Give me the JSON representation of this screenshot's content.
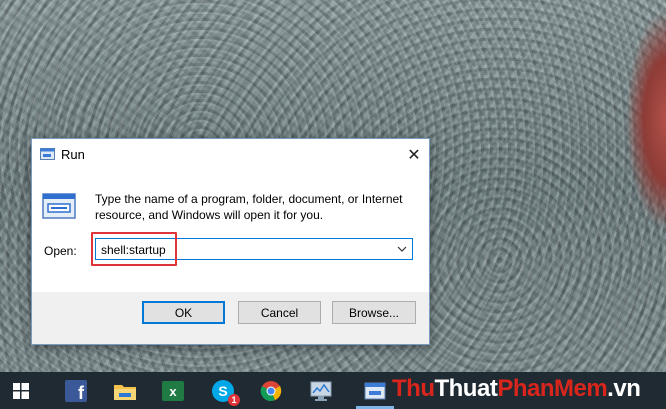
{
  "dialog": {
    "title": "Run",
    "close_glyph": "✕",
    "description": "Type the name of a program, folder, document, or Internet resource, and Windows will open it for you.",
    "open_label": "Open:",
    "open_value": "shell:startup",
    "buttons": {
      "ok": "OK",
      "cancel": "Cancel",
      "browse": "Browse..."
    }
  },
  "taskbar": {
    "items": [
      {
        "name": "start-button",
        "icon": "windows-icon"
      },
      {
        "name": "facebook",
        "icon": "facebook-icon",
        "label": "f"
      },
      {
        "name": "file-explorer",
        "icon": "folder-icon"
      },
      {
        "name": "excel",
        "icon": "excel-icon",
        "label": "x"
      },
      {
        "name": "skype",
        "icon": "skype-icon",
        "label": "S",
        "badge": "1"
      },
      {
        "name": "chrome",
        "icon": "chrome-icon"
      },
      {
        "name": "task-manager",
        "icon": "monitor-icon"
      },
      {
        "name": "run",
        "icon": "run-icon"
      }
    ]
  },
  "watermark": {
    "part1": "Thu",
    "part2": "Thuat",
    "part3": "PhanMem",
    "part4": ".vn"
  },
  "colors": {
    "accent": "#0078d7",
    "highlight": "#e0343b",
    "taskbar": "#1f2a33"
  }
}
